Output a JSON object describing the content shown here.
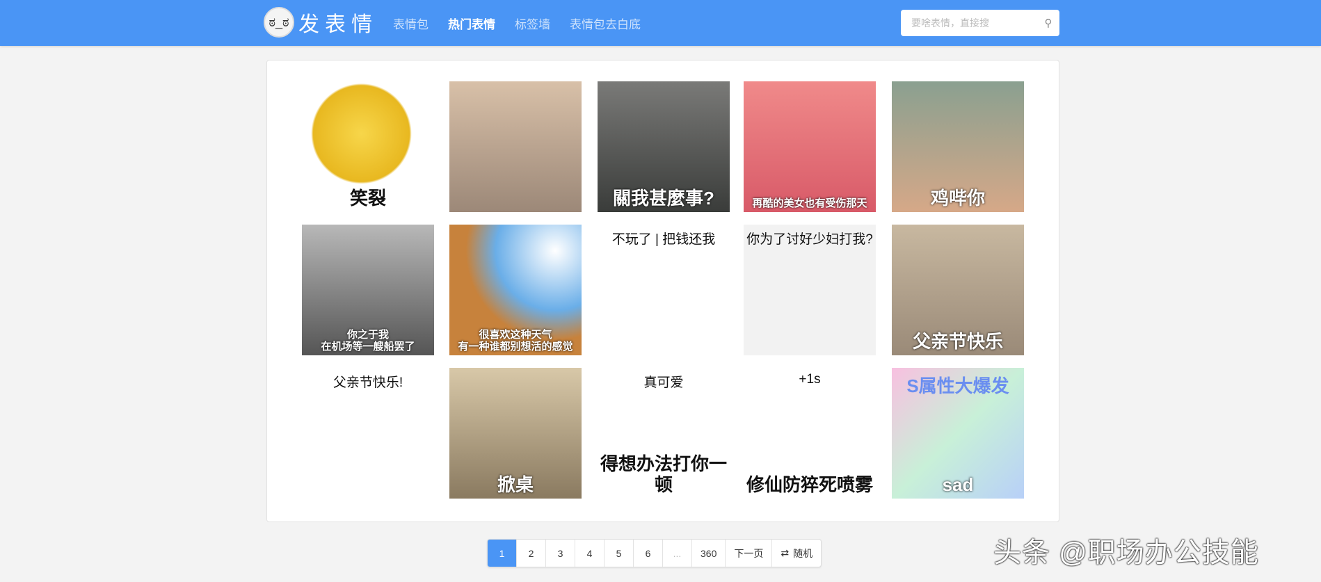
{
  "nav": {
    "logo_text": "发表情",
    "menu": [
      {
        "label": "表情包",
        "active": false
      },
      {
        "label": "热门表情",
        "active": true
      },
      {
        "label": "标签墙",
        "active": false
      },
      {
        "label": "表情包去白底",
        "active": false
      }
    ],
    "search_placeholder": "要啥表情，直接搜"
  },
  "tiles": [
    {
      "caption": "笑裂",
      "top": ""
    },
    {
      "caption": "",
      "top": ""
    },
    {
      "caption": "關我甚麼事?",
      "top": ""
    },
    {
      "caption": "再酷的美女也有受伤那天",
      "top": ""
    },
    {
      "caption": "鸡哔你",
      "top": ""
    },
    {
      "caption": "你之于我\n在机场等一艘船罢了",
      "top": ""
    },
    {
      "caption": "很喜欢这种天气\n有一种谁都别想活的感觉",
      "top": ""
    },
    {
      "caption": "",
      "top": "不玩了 | 把钱还我"
    },
    {
      "caption": "",
      "top": "你为了讨好少妇打我?"
    },
    {
      "caption": "父亲节快乐",
      "top": ""
    },
    {
      "caption": "",
      "top": "父亲节快乐!"
    },
    {
      "caption": "掀桌",
      "top": ""
    },
    {
      "caption": "得想办法打你一顿",
      "top": "真可爱"
    },
    {
      "caption": "修仙防猝死喷雾",
      "top": "+1s"
    },
    {
      "caption": "sad",
      "top": "S属性大爆发"
    }
  ],
  "pagination": {
    "pages": [
      "1",
      "2",
      "3",
      "4",
      "5",
      "6",
      "...",
      "360"
    ],
    "current": "1",
    "next_label": "下一页",
    "random_label": "随机"
  },
  "watermark": "头条 @职场办公技能"
}
